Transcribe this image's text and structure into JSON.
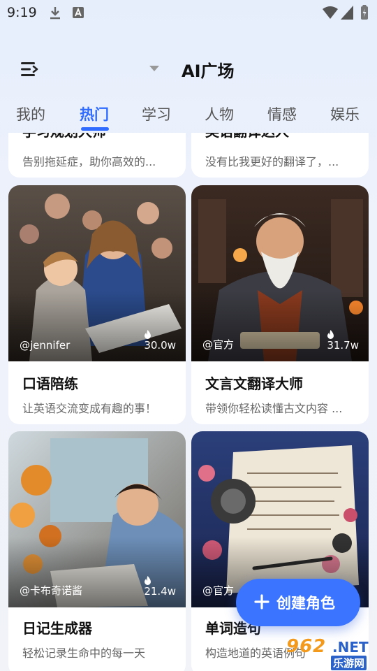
{
  "status": {
    "time": "9:19"
  },
  "header": {
    "title": "AI广场"
  },
  "tabs": [
    {
      "label": "我的"
    },
    {
      "label": "热门",
      "active": true
    },
    {
      "label": "学习"
    },
    {
      "label": "人物"
    },
    {
      "label": "情感"
    },
    {
      "label": "娱乐"
    }
  ],
  "cards": [
    {
      "title": "学习规划大师",
      "desc": "告别拖延症，助你高效的...",
      "author": "",
      "count": ""
    },
    {
      "title": "英语翻译达人",
      "desc": "没有比我更好的翻译了，...",
      "author": "",
      "count": ""
    },
    {
      "title": "口语陪练",
      "desc": "让英语交流变成有趣的事！",
      "author": "@jennifer",
      "count": "30.0w"
    },
    {
      "title": "文言文翻译大师",
      "desc": "带领你轻松读懂古文内容 ...",
      "author": "@官方",
      "count": "31.7w"
    },
    {
      "title": "日记生成器",
      "desc": "轻松记录生命中的每一天",
      "author": "@卡布奇诺酱",
      "count": "21.4w"
    },
    {
      "title": "单词造句",
      "desc": "构造地道的英语例句",
      "author": "@官方",
      "count": ""
    }
  ],
  "fab": {
    "label": "创建角色"
  },
  "watermark": {
    "num": "962",
    "net": ".NET",
    "cn": "乐游网"
  },
  "colors": {
    "accent": "#2f6bff",
    "fab": "#3a74ff",
    "card": "#ffffff"
  }
}
